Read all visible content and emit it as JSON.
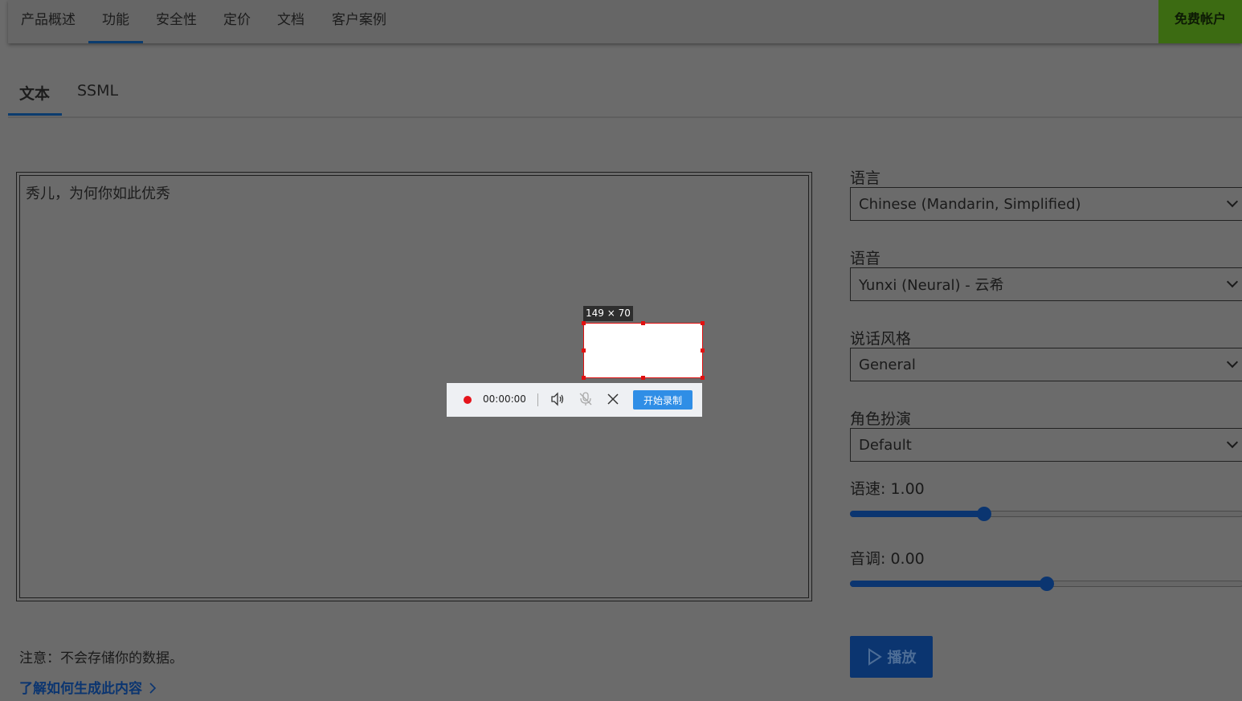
{
  "nav": {
    "items": [
      "产品概述",
      "功能",
      "安全性",
      "定价",
      "文档",
      "客户案例"
    ],
    "active": "功能",
    "free_account": "免费帐户"
  },
  "tabs": {
    "text": "文本",
    "ssml": "SSML",
    "active": "文本"
  },
  "editor": {
    "content": "秀儿，为何你如此优秀"
  },
  "settings": {
    "language_label": "语言",
    "language_value": "Chinese (Mandarin, Simplified)",
    "voice_label": "语音",
    "voice_value": "Yunxi (Neural) - 云希",
    "style_label": "说话风格",
    "style_value": "General",
    "role_label": "角色扮演",
    "role_value": "Default",
    "speed_label": "语速: 1.00",
    "speed_fraction": 0.34,
    "pitch_label": "音调: 0.00",
    "pitch_fraction": 0.5,
    "play_label": "播放"
  },
  "footer": {
    "note": "注意：不会存储你的数据。",
    "learn_link": "了解如何生成此内容"
  },
  "recorder": {
    "selection_size": "149 × 70",
    "time": "00:00:00",
    "start_label": "开始录制",
    "rec_color": "#e5141b"
  }
}
